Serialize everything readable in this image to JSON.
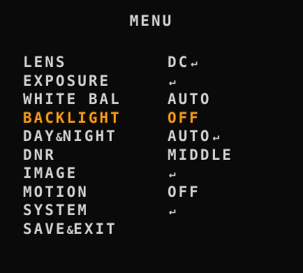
{
  "menu": {
    "title": "MENU",
    "selected_color": "#f39a1e",
    "text_color": "#cfcfcf",
    "enter_icon_glyph": "↵",
    "items": [
      {
        "label_parts": [
          "LENS"
        ],
        "value": "DC",
        "has_submenu": true,
        "selected": false
      },
      {
        "label_parts": [
          "EXPOSURE"
        ],
        "value": "",
        "has_submenu": true,
        "selected": false
      },
      {
        "label_parts": [
          "WHITE BAL"
        ],
        "value": "AUTO",
        "has_submenu": false,
        "selected": false
      },
      {
        "label_parts": [
          "BACKLIGHT"
        ],
        "value": "OFF",
        "has_submenu": false,
        "selected": true
      },
      {
        "label_parts": [
          "DAY",
          "&",
          "NIGHT"
        ],
        "value": "AUTO",
        "has_submenu": true,
        "selected": false
      },
      {
        "label_parts": [
          "DNR"
        ],
        "value": "MIDDLE",
        "has_submenu": false,
        "selected": false
      },
      {
        "label_parts": [
          "IMAGE"
        ],
        "value": "",
        "has_submenu": true,
        "selected": false
      },
      {
        "label_parts": [
          "MOTION"
        ],
        "value": "OFF",
        "has_submenu": false,
        "selected": false
      },
      {
        "label_parts": [
          "SYSTEM"
        ],
        "value": "",
        "has_submenu": true,
        "selected": false
      },
      {
        "label_parts": [
          "SAVE",
          "&",
          "EXIT"
        ],
        "value": "",
        "has_submenu": false,
        "selected": false
      }
    ]
  }
}
